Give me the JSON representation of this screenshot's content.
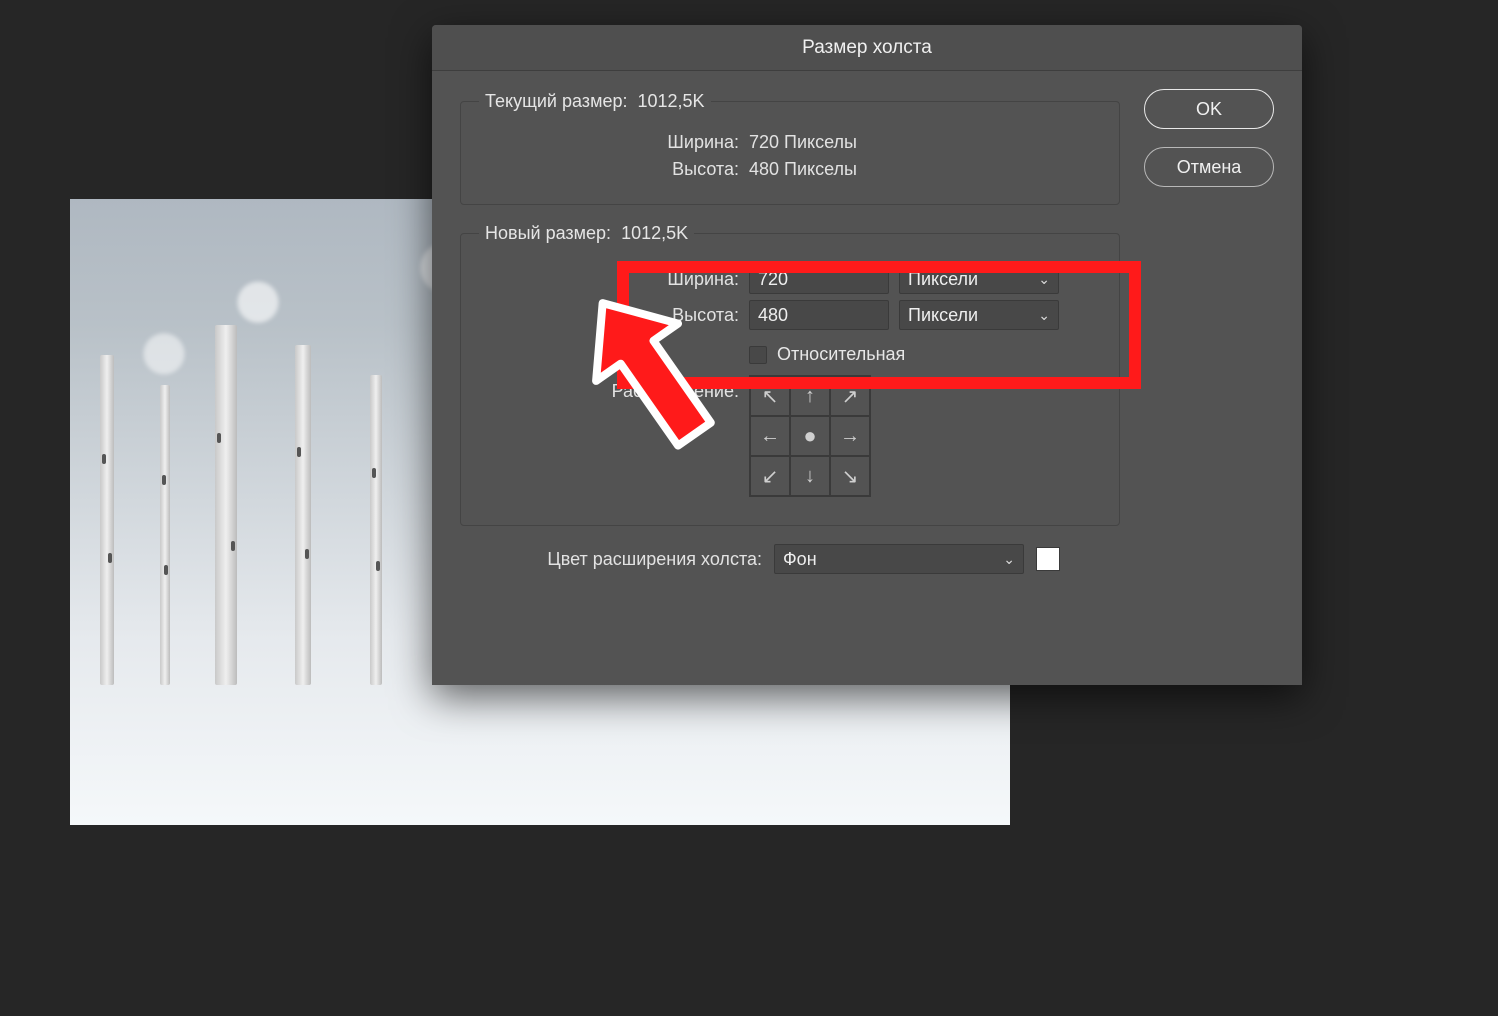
{
  "dialog": {
    "title": "Размер холста",
    "current": {
      "legend_label": "Текущий размер:",
      "legend_value": "1012,5K",
      "width_label": "Ширина:",
      "width_value": "720 Пикселы",
      "height_label": "Высота:",
      "height_value": "480 Пикселы"
    },
    "new": {
      "legend_label": "Новый размер:",
      "legend_value": "1012,5K",
      "width_label": "Ширина:",
      "width_value": "720",
      "width_unit": "Пиксели",
      "height_label": "Высота:",
      "height_value": "480",
      "height_unit": "Пиксели",
      "relative_label": "Относительная",
      "anchor_label": "Расположение:"
    },
    "extension": {
      "label": "Цвет расширения холста:",
      "value": "Фон"
    },
    "buttons": {
      "ok": "OK",
      "cancel": "Отмена"
    }
  }
}
